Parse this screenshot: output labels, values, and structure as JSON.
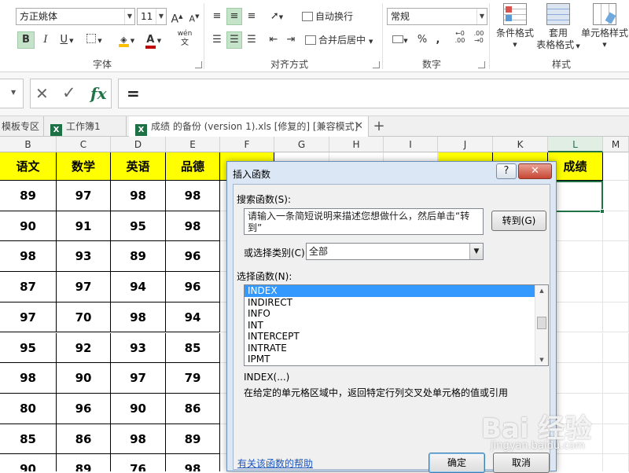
{
  "ribbon": {
    "font_name": "方正姚体",
    "font_size": "11",
    "bold_icon": "B",
    "italic_icon": "I",
    "underline_icon": "U",
    "grow_font_icon": "A",
    "shrink_font_icon": "A",
    "phonetic_icon": "wén",
    "wrap_text_label": "自动换行",
    "merge_center_label": "合并后居中",
    "number_format": "常规",
    "percent_icon": "%",
    "comma_icon": ",",
    "conditional_format_label": "条件格式",
    "format_table_label_1": "套用",
    "format_table_label_2": "表格格式",
    "cell_styles_label": "单元格样式",
    "group_font": "字体",
    "group_alignment": "对齐方式",
    "group_number": "数字",
    "group_styles": "样式",
    "accent": "#217346",
    "font_color": "#c00000",
    "fill_color": "#ffc000"
  },
  "formula_bar": {
    "cancel_icon": "✕",
    "enter_icon": "✓",
    "fx_icon": "fx",
    "content": "="
  },
  "tabs": {
    "templates": "模板专区",
    "workbook1": "工作簿1",
    "active": "成绩 的备份 (version 1).xls [修复的]  [兼容模式]",
    "close_icon": "✕",
    "add_icon": "+"
  },
  "grid": {
    "columns": [
      "B",
      "C",
      "D",
      "E",
      "F",
      "G",
      "H",
      "I",
      "J",
      "K",
      "L",
      "M"
    ],
    "header_row": [
      "语文",
      "数学",
      "英语",
      "品德",
      "",
      "",
      "",
      "",
      "",
      "",
      "成绩",
      ""
    ],
    "rows": [
      [
        "89",
        "97",
        "98",
        "98"
      ],
      [
        "90",
        "91",
        "95",
        "98"
      ],
      [
        "98",
        "93",
        "89",
        "96"
      ],
      [
        "87",
        "97",
        "94",
        "96"
      ],
      [
        "97",
        "70",
        "98",
        "94"
      ],
      [
        "95",
        "92",
        "93",
        "85"
      ],
      [
        "98",
        "90",
        "97",
        "79"
      ],
      [
        "80",
        "96",
        "90",
        "86"
      ],
      [
        "85",
        "86",
        "98",
        "89"
      ],
      [
        "90",
        "89",
        "76",
        "98"
      ]
    ]
  },
  "dialog": {
    "title": "插入函数",
    "help_icon": "?",
    "close_icon": "✕",
    "search_label": "搜索函数(S):",
    "search_placeholder": "请输入一条简短说明来描述您想做什么，然后单击“转到”",
    "go_button": "转到(G)",
    "category_label": "或选择类别(C):",
    "category_value": "全部",
    "list_label": "选择函数(N):",
    "functions": [
      "INDEX",
      "INDIRECT",
      "INFO",
      "INT",
      "INTERCEPT",
      "INTRATE",
      "IPMT"
    ],
    "selected_function": "INDEX",
    "signature": "INDEX(...)",
    "description": "在给定的单元格区域中，返回特定行列交叉处单元格的值或引用",
    "help_link": "有关该函数的帮助",
    "ok_button": "确定",
    "cancel_button": "取消"
  },
  "watermark": {
    "text": "Bai  经验",
    "url": "jingyan.baidu.com"
  }
}
